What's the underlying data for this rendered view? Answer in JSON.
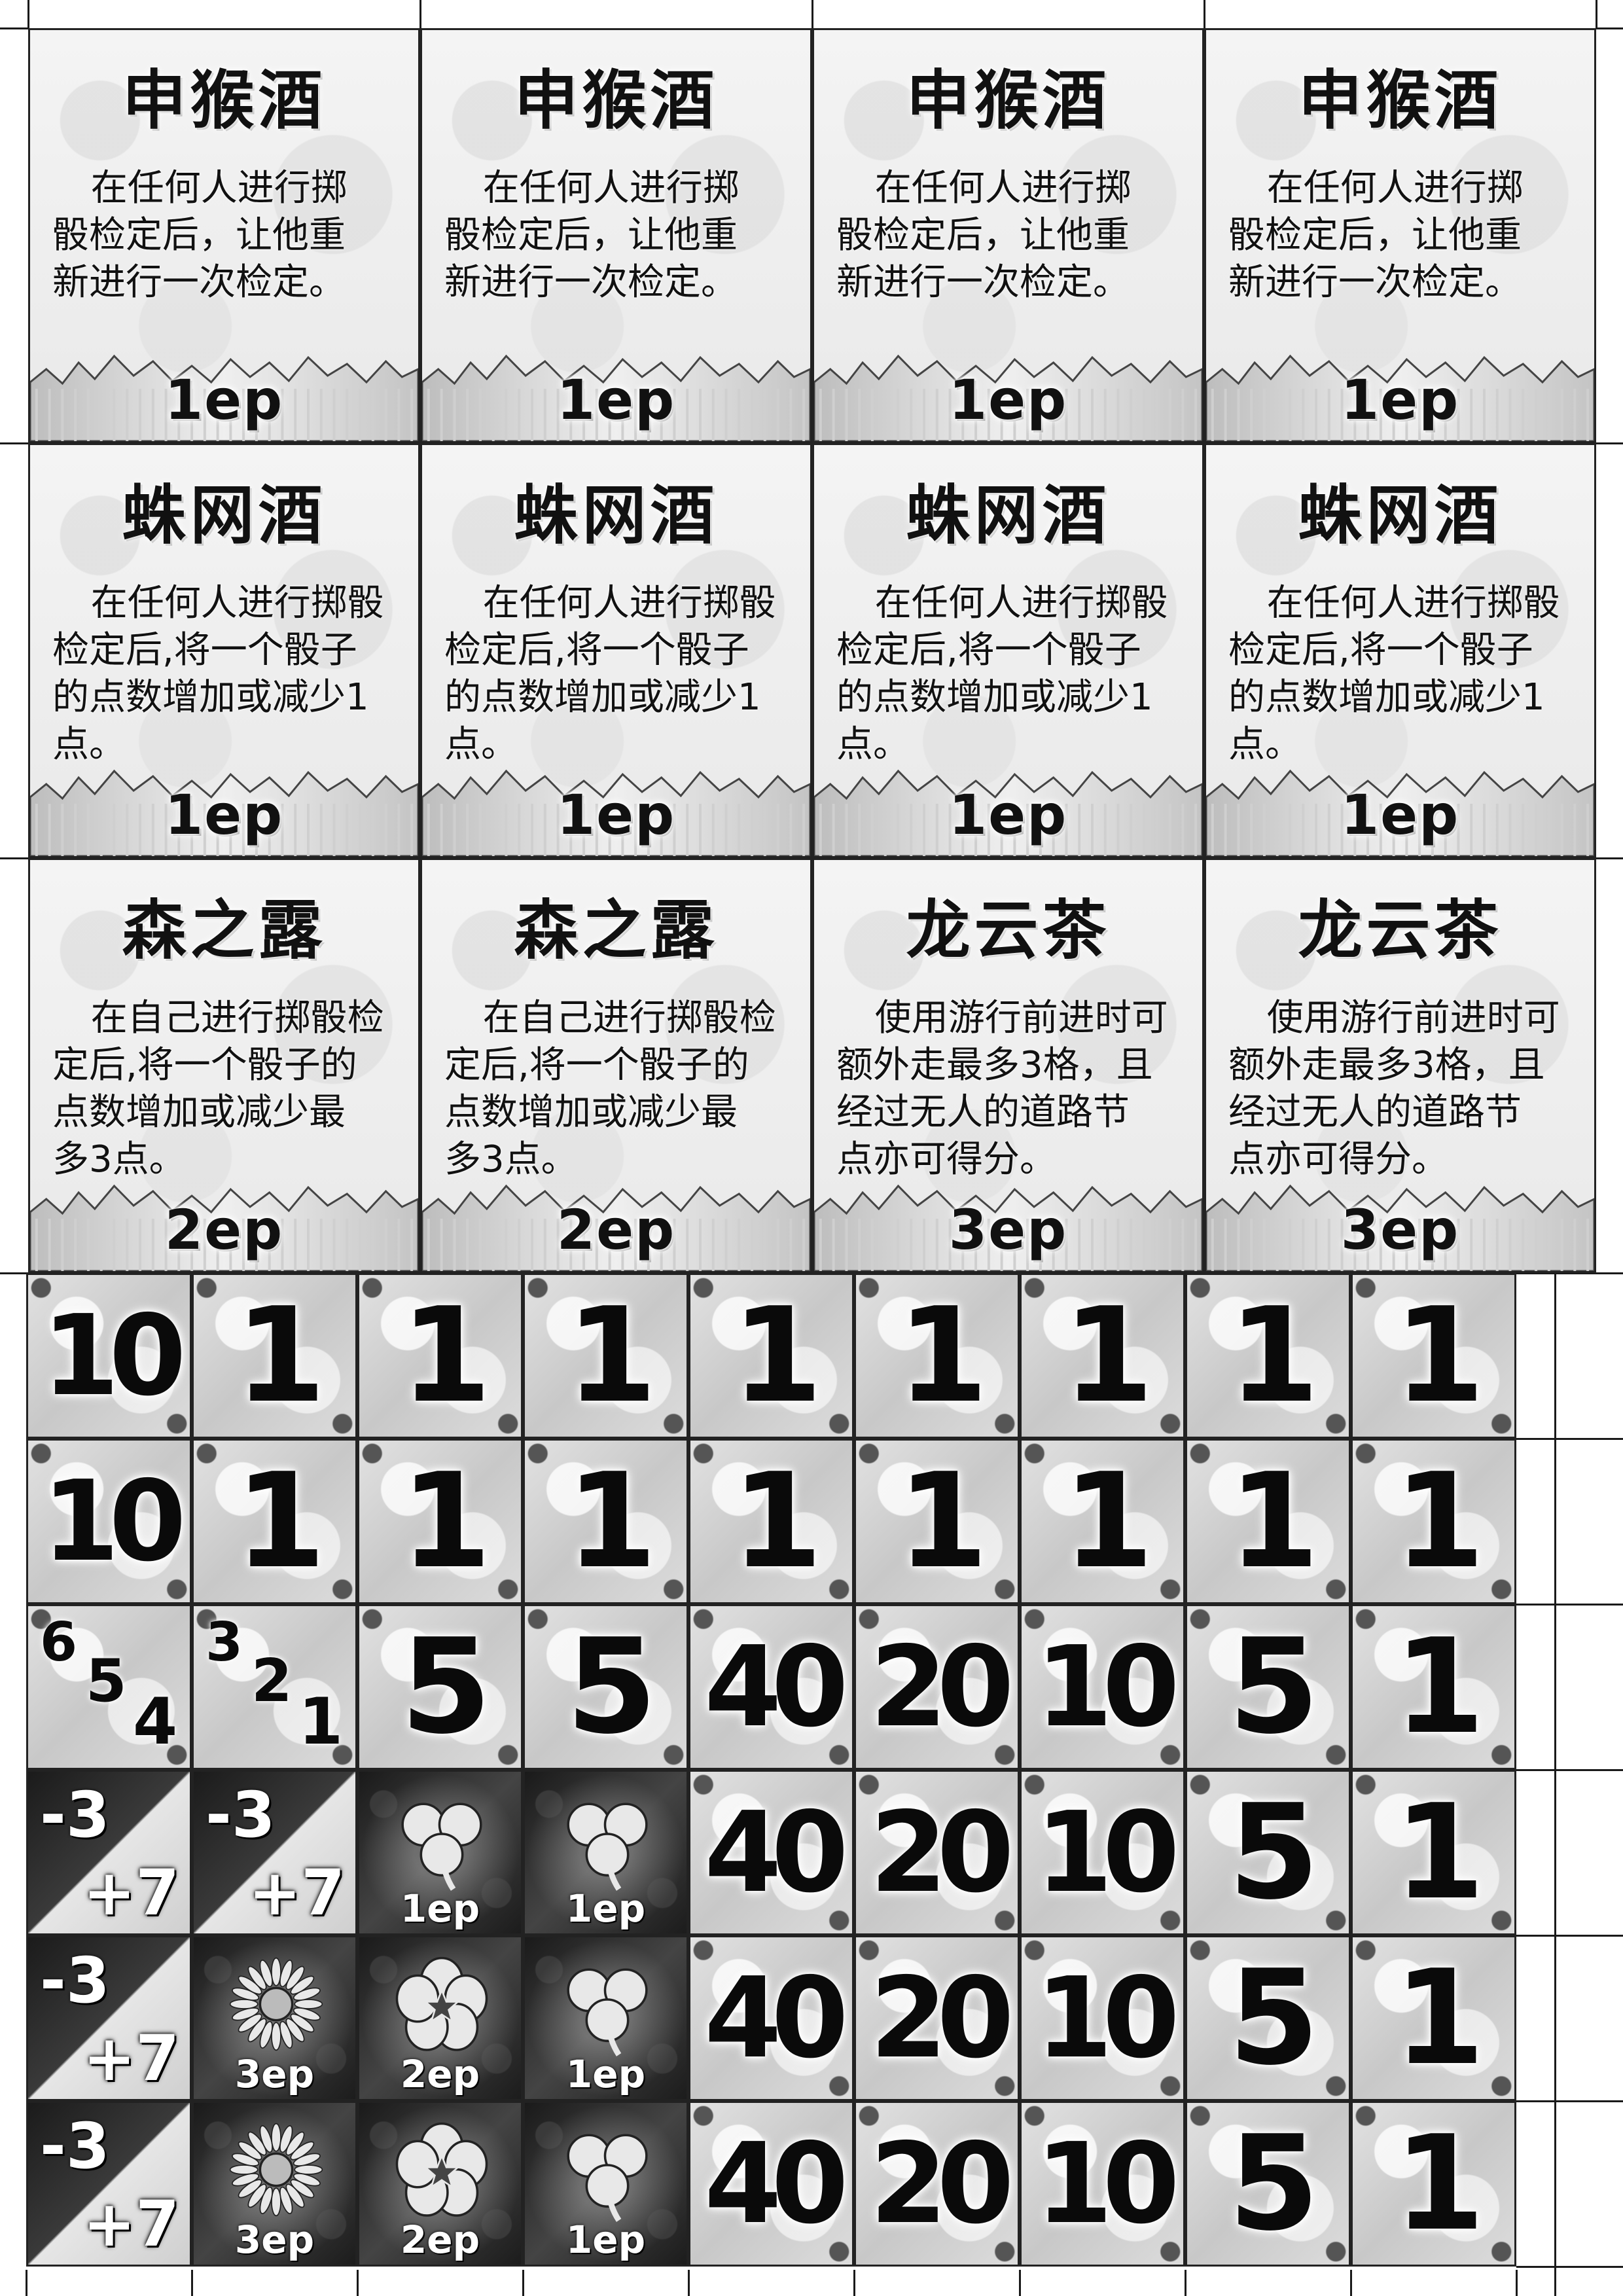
{
  "cards": [
    {
      "title": "申猴酒",
      "desc": "在任何人进行掷\n骰检定后，让他重\n新进行一次检定。",
      "cost": "1ep"
    },
    {
      "title": "申猴酒",
      "desc": "在任何人进行掷\n骰检定后，让他重\n新进行一次检定。",
      "cost": "1ep"
    },
    {
      "title": "申猴酒",
      "desc": "在任何人进行掷\n骰检定后，让他重\n新进行一次检定。",
      "cost": "1ep"
    },
    {
      "title": "申猴酒",
      "desc": "在任何人进行掷\n骰检定后，让他重\n新进行一次检定。",
      "cost": "1ep"
    },
    {
      "title": "蛛网酒",
      "desc": "在任何人进行掷骰\n检定后,将一个骰子\n的点数增加或减少1\n点。",
      "cost": "1ep"
    },
    {
      "title": "蛛网酒",
      "desc": "在任何人进行掷骰\n检定后,将一个骰子\n的点数增加或减少1\n点。",
      "cost": "1ep"
    },
    {
      "title": "蛛网酒",
      "desc": "在任何人进行掷骰\n检定后,将一个骰子\n的点数增加或减少1\n点。",
      "cost": "1ep"
    },
    {
      "title": "蛛网酒",
      "desc": "在任何人进行掷骰\n检定后,将一个骰子\n的点数增加或减少1\n点。",
      "cost": "1ep"
    },
    {
      "title": "森之露",
      "desc": "在自己进行掷骰检\n定后,将一个骰子的\n点数增加或减少最\n多3点。",
      "cost": "2ep"
    },
    {
      "title": "森之露",
      "desc": "在自己进行掷骰检\n定后,将一个骰子的\n点数增加或减少最\n多3点。",
      "cost": "2ep"
    },
    {
      "title": "龙云茶",
      "desc": "使用游行前进时可\n额外走最多3格，且\n经过无人的道路节\n点亦可得分。",
      "cost": "3ep"
    },
    {
      "title": "龙云茶",
      "desc": "使用游行前进时可\n额外走最多3格，且\n经过无人的道路节\n点亦可得分。",
      "cost": "3ep"
    }
  ],
  "token_rows": [
    [
      {
        "t": "num",
        "v": "10"
      },
      {
        "t": "num",
        "v": "1"
      },
      {
        "t": "num",
        "v": "1"
      },
      {
        "t": "num",
        "v": "1"
      },
      {
        "t": "num",
        "v": "1"
      },
      {
        "t": "num",
        "v": "1"
      },
      {
        "t": "num",
        "v": "1"
      },
      {
        "t": "num",
        "v": "1"
      },
      {
        "t": "num",
        "v": "1"
      }
    ],
    [
      {
        "t": "num",
        "v": "10"
      },
      {
        "t": "num",
        "v": "1"
      },
      {
        "t": "num",
        "v": "1"
      },
      {
        "t": "num",
        "v": "1"
      },
      {
        "t": "num",
        "v": "1"
      },
      {
        "t": "num",
        "v": "1"
      },
      {
        "t": "num",
        "v": "1"
      },
      {
        "t": "num",
        "v": "1"
      },
      {
        "t": "num",
        "v": "1"
      }
    ],
    [
      {
        "t": "dice",
        "a": "6",
        "b": "5",
        "c": "4"
      },
      {
        "t": "dice",
        "a": "3",
        "b": "2",
        "c": "1"
      },
      {
        "t": "num",
        "v": "5"
      },
      {
        "t": "num",
        "v": "5"
      },
      {
        "t": "num",
        "v": "40"
      },
      {
        "t": "num",
        "v": "20"
      },
      {
        "t": "num",
        "v": "10"
      },
      {
        "t": "num",
        "v": "5"
      },
      {
        "t": "num",
        "v": "1"
      }
    ],
    [
      {
        "t": "split",
        "top": "-3",
        "bot": "+7"
      },
      {
        "t": "split",
        "top": "-3",
        "bot": "+7"
      },
      {
        "t": "flower",
        "icon": "clover-icon",
        "ep": "1ep"
      },
      {
        "t": "flower",
        "icon": "clover-icon",
        "ep": "1ep"
      },
      {
        "t": "num",
        "v": "40"
      },
      {
        "t": "num",
        "v": "20"
      },
      {
        "t": "num",
        "v": "10"
      },
      {
        "t": "num",
        "v": "5"
      },
      {
        "t": "num",
        "v": "1"
      }
    ],
    [
      {
        "t": "split",
        "top": "-3",
        "bot": "+7"
      },
      {
        "t": "flower",
        "icon": "daisy-icon",
        "ep": "3ep"
      },
      {
        "t": "flower",
        "icon": "blossom-icon",
        "ep": "2ep"
      },
      {
        "t": "flower",
        "icon": "clover-icon",
        "ep": "1ep"
      },
      {
        "t": "num",
        "v": "40"
      },
      {
        "t": "num",
        "v": "20"
      },
      {
        "t": "num",
        "v": "10"
      },
      {
        "t": "num",
        "v": "5"
      },
      {
        "t": "num",
        "v": "1"
      }
    ],
    [
      {
        "t": "split",
        "top": "-3",
        "bot": "+7"
      },
      {
        "t": "flower",
        "icon": "daisy-icon",
        "ep": "3ep"
      },
      {
        "t": "flower",
        "icon": "blossom-icon",
        "ep": "2ep"
      },
      {
        "t": "flower",
        "icon": "clover-icon",
        "ep": "1ep"
      },
      {
        "t": "num",
        "v": "40"
      },
      {
        "t": "num",
        "v": "20"
      },
      {
        "t": "num",
        "v": "10"
      },
      {
        "t": "num",
        "v": "5"
      },
      {
        "t": "num",
        "v": "1"
      }
    ]
  ]
}
